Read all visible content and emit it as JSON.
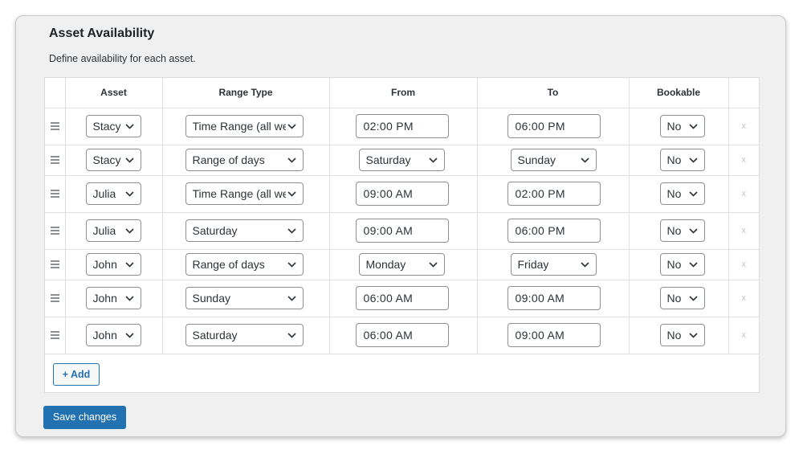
{
  "section": {
    "title": "Asset Availability",
    "description": "Define availability for each asset."
  },
  "table": {
    "headers": [
      "",
      "Asset",
      "Range Type",
      "From",
      "To",
      "Bookable",
      ""
    ],
    "rows": [
      {
        "asset": "Stacy",
        "range_type": "Time Range (all week)",
        "from": "02:00 PM",
        "to": "06:00 PM",
        "bookable": "No",
        "from_kind": "time"
      },
      {
        "asset": "Stacy",
        "range_type": "Range of days",
        "from": "Saturday",
        "to": "Sunday",
        "bookable": "No",
        "from_kind": "day"
      },
      {
        "asset": "Julia",
        "range_type": "Time Range (all week)",
        "from": "09:00 AM",
        "to": "02:00 PM",
        "bookable": "No",
        "from_kind": "time"
      },
      {
        "asset": "Julia",
        "range_type": "Saturday",
        "from": "09:00 AM",
        "to": "06:00 PM",
        "bookable": "No",
        "from_kind": "time"
      },
      {
        "asset": "John",
        "range_type": "Range of days",
        "from": "Monday",
        "to": "Friday",
        "bookable": "No",
        "from_kind": "day"
      },
      {
        "asset": "John",
        "range_type": "Sunday",
        "from": "06:00 AM",
        "to": "09:00 AM",
        "bookable": "No",
        "from_kind": "time"
      },
      {
        "asset": "John",
        "range_type": "Saturday",
        "from": "06:00 AM",
        "to": "09:00 AM",
        "bookable": "No",
        "from_kind": "time"
      }
    ],
    "delete_glyph": "x"
  },
  "buttons": {
    "add_label": "+ Add",
    "save_label": "Save changes"
  },
  "colors": {
    "accent": "#2271b1",
    "card_bg": "#f0f0f1"
  },
  "icons": {
    "drag": "drag-handle-icon",
    "select": "chevron-down-icon",
    "delete": "delete-icon"
  }
}
